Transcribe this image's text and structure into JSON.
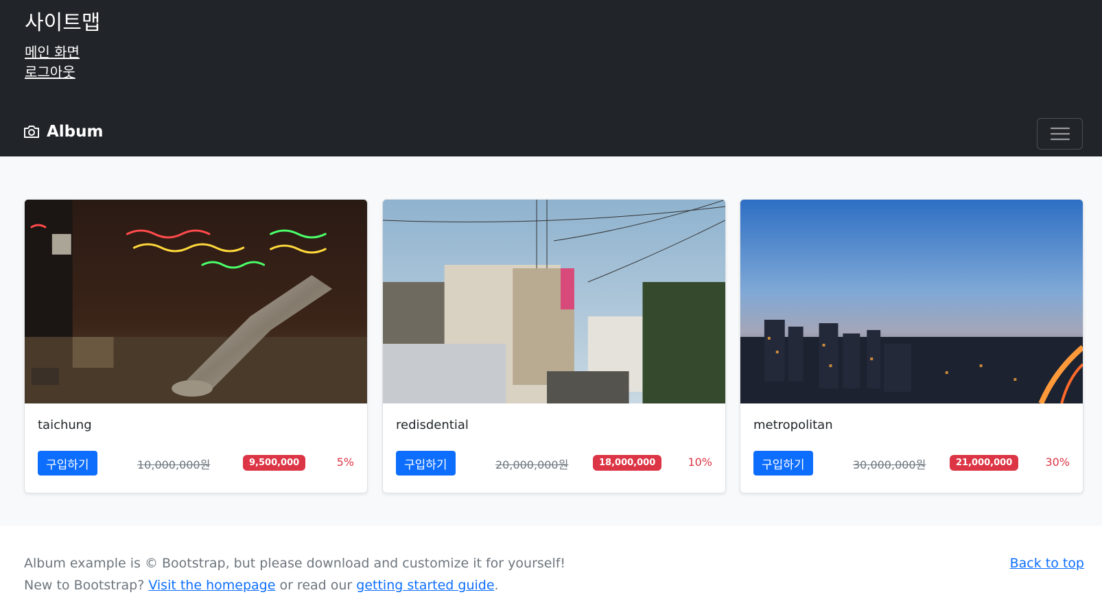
{
  "header": {
    "sitemap_title": "사이트맵",
    "links": [
      "메인 화면",
      "로그아웃"
    ],
    "brand": "Album",
    "brand_icon": "camera-icon",
    "toggler_icon": "hamburger-menu-icon"
  },
  "cards": [
    {
      "title": "taichung",
      "buy_label": "구입하기",
      "original_price": "10,000,000원",
      "sale_price": "9,500,000",
      "discount": "5%"
    },
    {
      "title": "redisdential",
      "buy_label": "구입하기",
      "original_price": "20,000,000원",
      "sale_price": "18,000,000",
      "discount": "10%"
    },
    {
      "title": "metropolitan",
      "buy_label": "구입하기",
      "original_price": "30,000,000원",
      "sale_price": "21,000,000",
      "discount": "30%"
    }
  ],
  "footer": {
    "line1": "Album example is © Bootstrap, but please download and customize it for yourself!",
    "line2_prefix": "New to Bootstrap?",
    "homepage_link": "Visit the homepage",
    "line2_middle": "or read our",
    "guide_link": "getting started guide",
    "line2_suffix": ".",
    "back_to_top": "Back to top"
  },
  "colors": {
    "header_bg": "#212529",
    "primary": "#0d6efd",
    "danger": "#dc3545",
    "album_bg": "#f8f9fa"
  }
}
